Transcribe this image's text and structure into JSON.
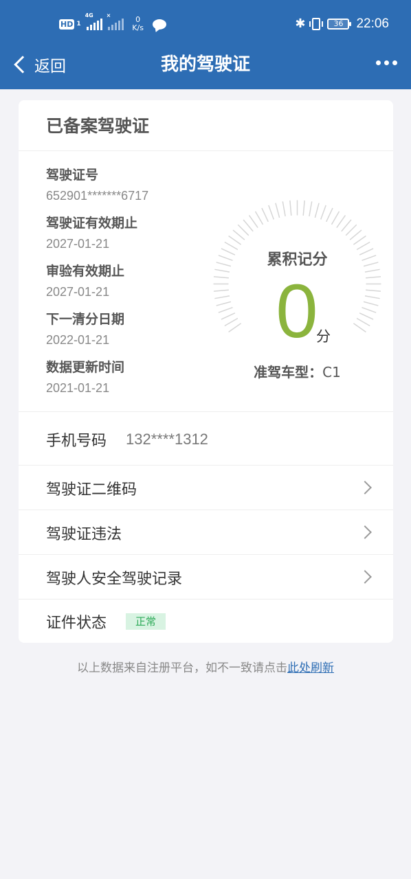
{
  "status_bar": {
    "hd": "HD",
    "hd_sub": "1",
    "network": "4G",
    "sim2_marker": "×",
    "speed_value": "0",
    "speed_unit": "K/s",
    "battery": "36",
    "time": "22:06"
  },
  "nav": {
    "back_label": "返回",
    "title": "我的驾驶证",
    "more_icon": "ellipsis-icon"
  },
  "card": {
    "title": "已备案驾驶证",
    "fields": [
      {
        "label": "驾驶证号",
        "value": "652901*******6717"
      },
      {
        "label": "驾驶证有效期止",
        "value": "2027-01-21"
      },
      {
        "label": "审验有效期止",
        "value": "2027-01-21"
      },
      {
        "label": "下一清分日期",
        "value": "2022-01-21"
      },
      {
        "label": "数据更新时间",
        "value": "2021-01-21"
      }
    ],
    "score": {
      "title": "累积记分",
      "value": "0",
      "unit": "分",
      "class_label": "准驾车型：",
      "class_value": "C1"
    },
    "phone": {
      "label": "手机号码",
      "value": "132****1312"
    },
    "links": [
      {
        "label": "驾驶证二维码"
      },
      {
        "label": "驾驶证违法"
      },
      {
        "label": "驾驶人安全驾驶记录"
      }
    ],
    "status": {
      "label": "证件状态",
      "value": "正常"
    }
  },
  "footer": {
    "text": "以上数据来自注册平台，如不一致请点击",
    "link": "此处刷新"
  },
  "colors": {
    "header": "#2d6db4",
    "score": "#8bb43d",
    "status_badge_bg": "#d8f3e2",
    "status_badge_text": "#2daa58"
  }
}
